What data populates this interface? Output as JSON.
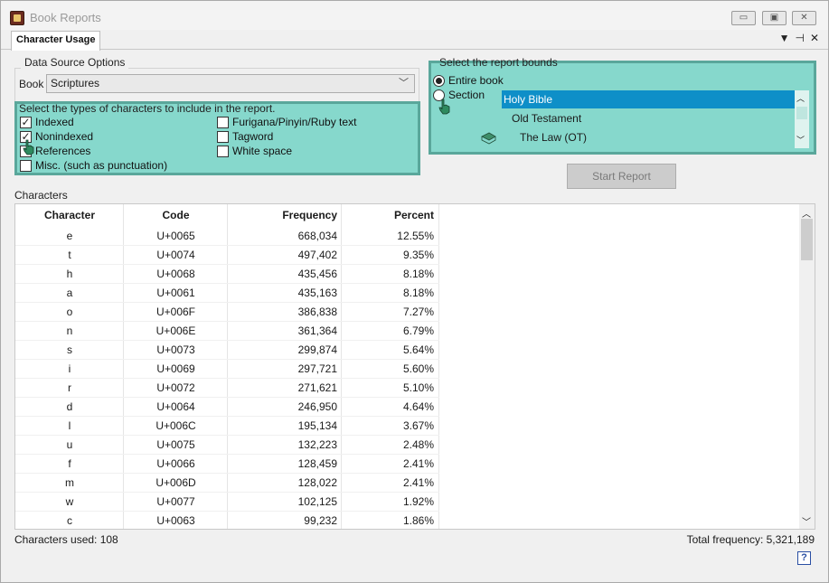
{
  "window": {
    "title": "Book Reports"
  },
  "tab": {
    "label": "Character Usage"
  },
  "data_source": {
    "group_label": "Data Source Options",
    "book_label": "Book",
    "book_value": "Scriptures",
    "types_label": "Select the types of characters to include in the report.",
    "checkboxes": [
      {
        "label": "Indexed",
        "checked": true
      },
      {
        "label": "Nonindexed",
        "checked": true
      },
      {
        "label": "References",
        "checked": false
      },
      {
        "label": "Misc. (such as punctuation)",
        "checked": false
      },
      {
        "label": "Furigana/Pinyin/Ruby text",
        "checked": false
      },
      {
        "label": "Tagword",
        "checked": false
      },
      {
        "label": "White space",
        "checked": false
      }
    ]
  },
  "bounds": {
    "label": "Select the report bounds",
    "entire_book": "Entire book",
    "section": "Section",
    "tree": [
      "Holy Bible",
      "Old Testament",
      "The Law (OT)"
    ]
  },
  "start_button": "Start Report",
  "characters": {
    "label": "Characters",
    "columns": [
      "Character",
      "Code",
      "Frequency",
      "Percent"
    ],
    "rows": [
      [
        "e",
        "U+0065",
        "668,034",
        "12.55%"
      ],
      [
        "t",
        "U+0074",
        "497,402",
        "9.35%"
      ],
      [
        "h",
        "U+0068",
        "435,456",
        "8.18%"
      ],
      [
        "a",
        "U+0061",
        "435,163",
        "8.18%"
      ],
      [
        "o",
        "U+006F",
        "386,838",
        "7.27%"
      ],
      [
        "n",
        "U+006E",
        "361,364",
        "6.79%"
      ],
      [
        "s",
        "U+0073",
        "299,874",
        "5.64%"
      ],
      [
        "i",
        "U+0069",
        "297,721",
        "5.60%"
      ],
      [
        "r",
        "U+0072",
        "271,621",
        "5.10%"
      ],
      [
        "d",
        "U+0064",
        "246,950",
        "4.64%"
      ],
      [
        "l",
        "U+006C",
        "195,134",
        "3.67%"
      ],
      [
        "u",
        "U+0075",
        "132,223",
        "2.48%"
      ],
      [
        "f",
        "U+0066",
        "128,459",
        "2.41%"
      ],
      [
        "m",
        "U+006D",
        "128,022",
        "2.41%"
      ],
      [
        "w",
        "U+0077",
        "102,125",
        "1.92%"
      ],
      [
        "c",
        "U+0063",
        "99,232",
        "1.86%"
      ]
    ]
  },
  "status": {
    "characters_used": "Characters used: 108",
    "total_frequency": "Total frequency: 5,321,189"
  },
  "icons": {
    "help": "help-icon",
    "book": "book-icon"
  },
  "colors": {
    "highlight": "#86d8cc",
    "highlight_border": "#5aa79b",
    "tree_selected": "#0e8fc8"
  }
}
